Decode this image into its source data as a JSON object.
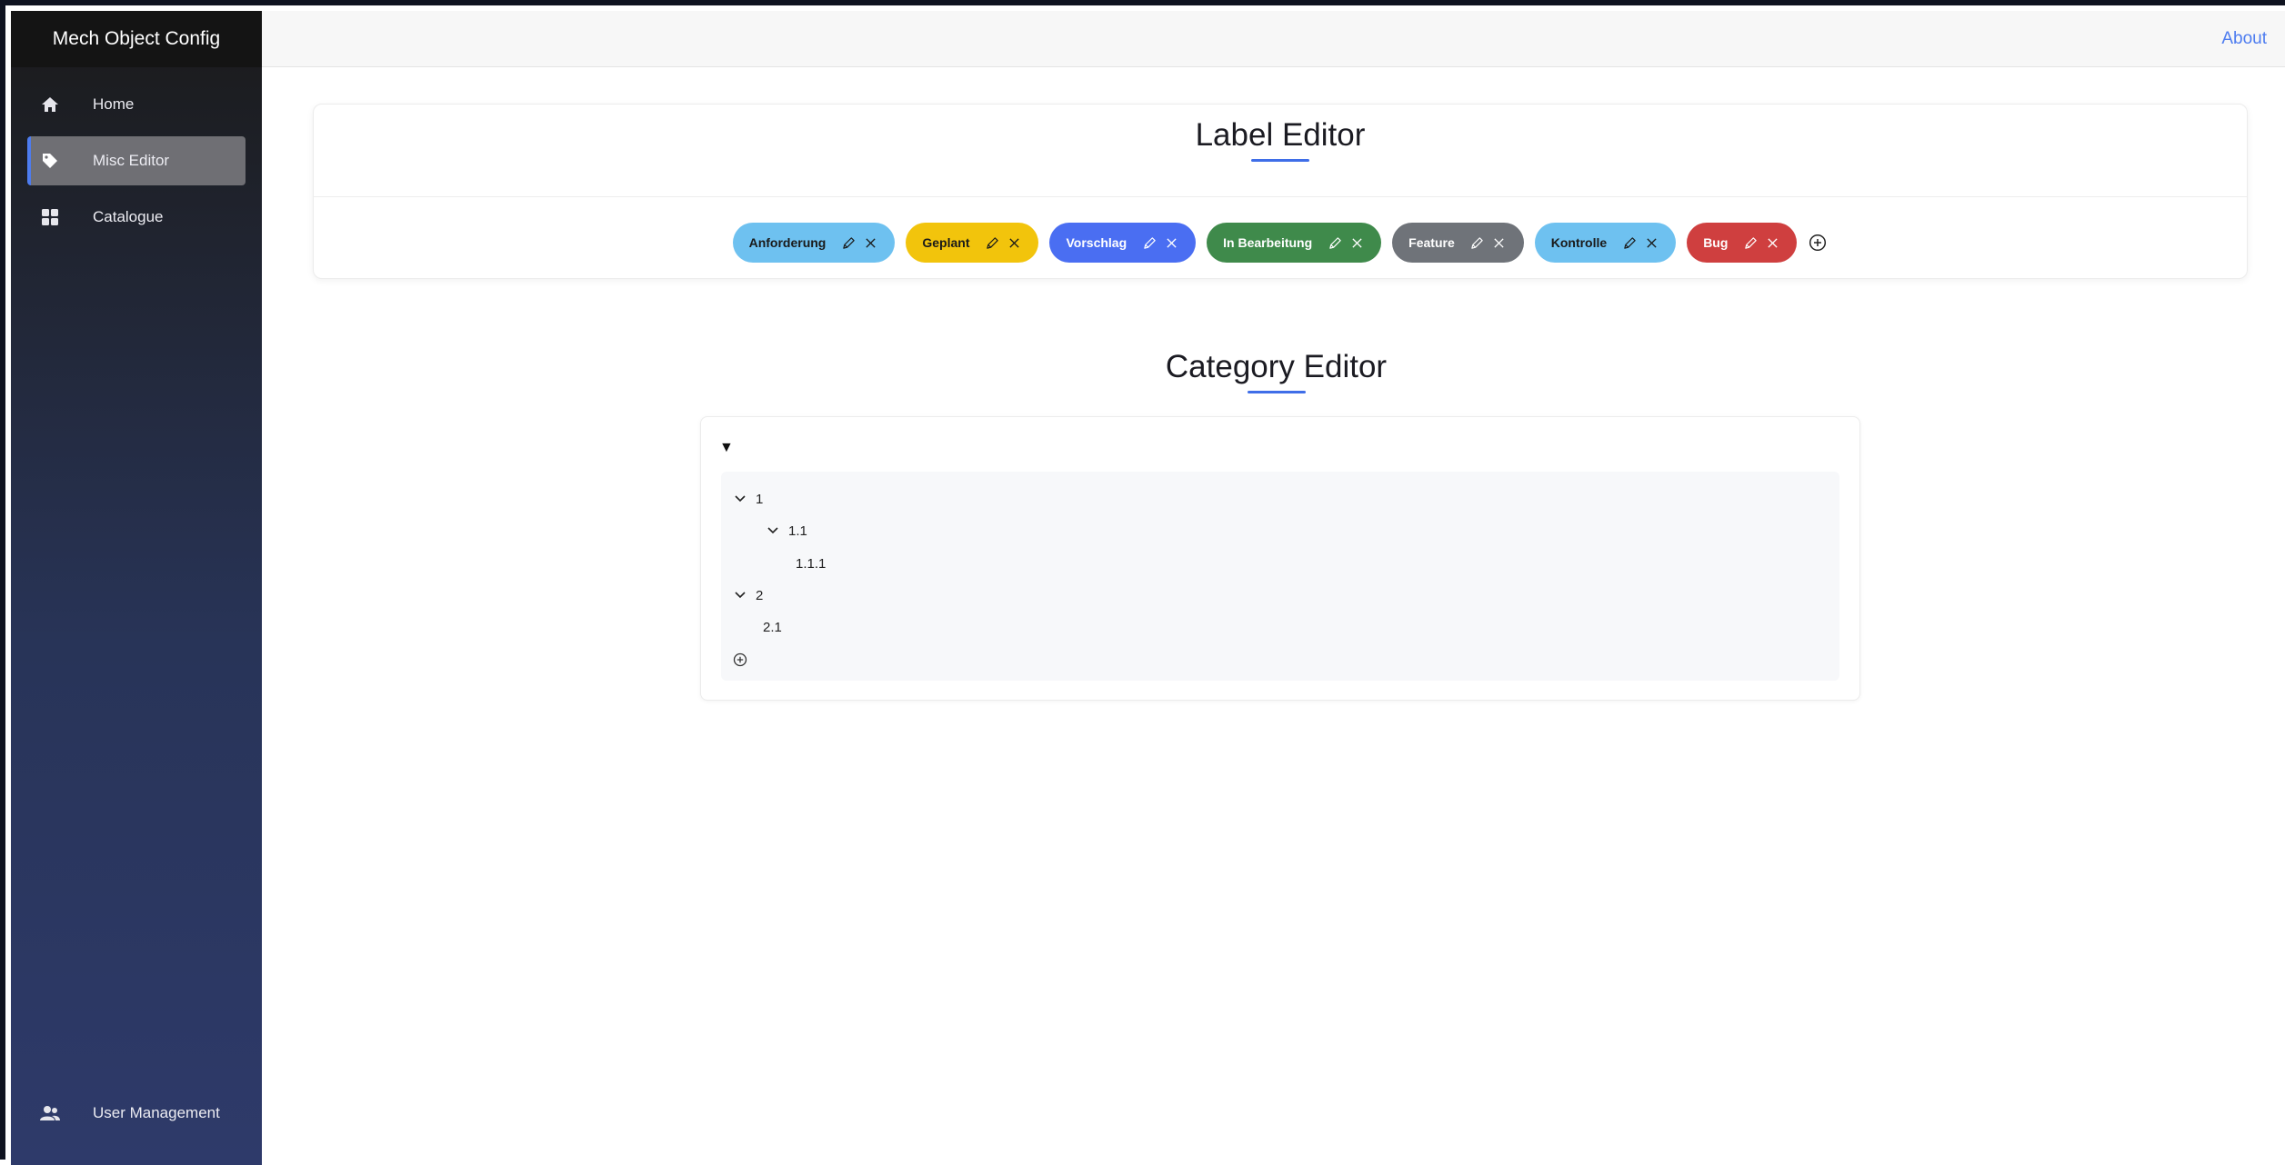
{
  "app": {
    "title": "Mech Object Config"
  },
  "sidebar": {
    "items": [
      {
        "label": "Home",
        "icon": "home-icon"
      },
      {
        "label": "Misc Editor",
        "icon": "tag-icon"
      },
      {
        "label": "Catalogue",
        "icon": "grid-icon"
      }
    ],
    "bottom_item": {
      "label": "User Management",
      "icon": "users-icon"
    }
  },
  "topbar": {
    "about_label": "About"
  },
  "label_editor": {
    "title": "Label Editor",
    "labels": [
      {
        "text": "Anforderung",
        "bg": "#6ec1f0",
        "fg": "#1a1a1a"
      },
      {
        "text": "Geplant",
        "bg": "#f2c40c",
        "fg": "#1a1a1a"
      },
      {
        "text": "Vorschlag",
        "bg": "#4a6ef2",
        "fg": "#ffffff"
      },
      {
        "text": "In Bearbeitung",
        "bg": "#3f8a4b",
        "fg": "#ffffff"
      },
      {
        "text": "Feature",
        "bg": "#6f7379",
        "fg": "#ffffff"
      },
      {
        "text": "Kontrolle",
        "bg": "#6ec1f0",
        "fg": "#1a1a1a"
      },
      {
        "text": "Bug",
        "bg": "#cf3f3f",
        "fg": "#ffffff"
      }
    ]
  },
  "category_editor": {
    "title": "Category Editor",
    "tree": [
      {
        "label": "1",
        "expanded": true
      },
      {
        "label": "1.1",
        "expanded": true
      },
      {
        "label": "1.1.1"
      },
      {
        "label": "2",
        "expanded": true
      },
      {
        "label": "2.1"
      }
    ]
  },
  "colors": {
    "accent": "#4d7cf0",
    "active_nav": "#6f6f74"
  }
}
